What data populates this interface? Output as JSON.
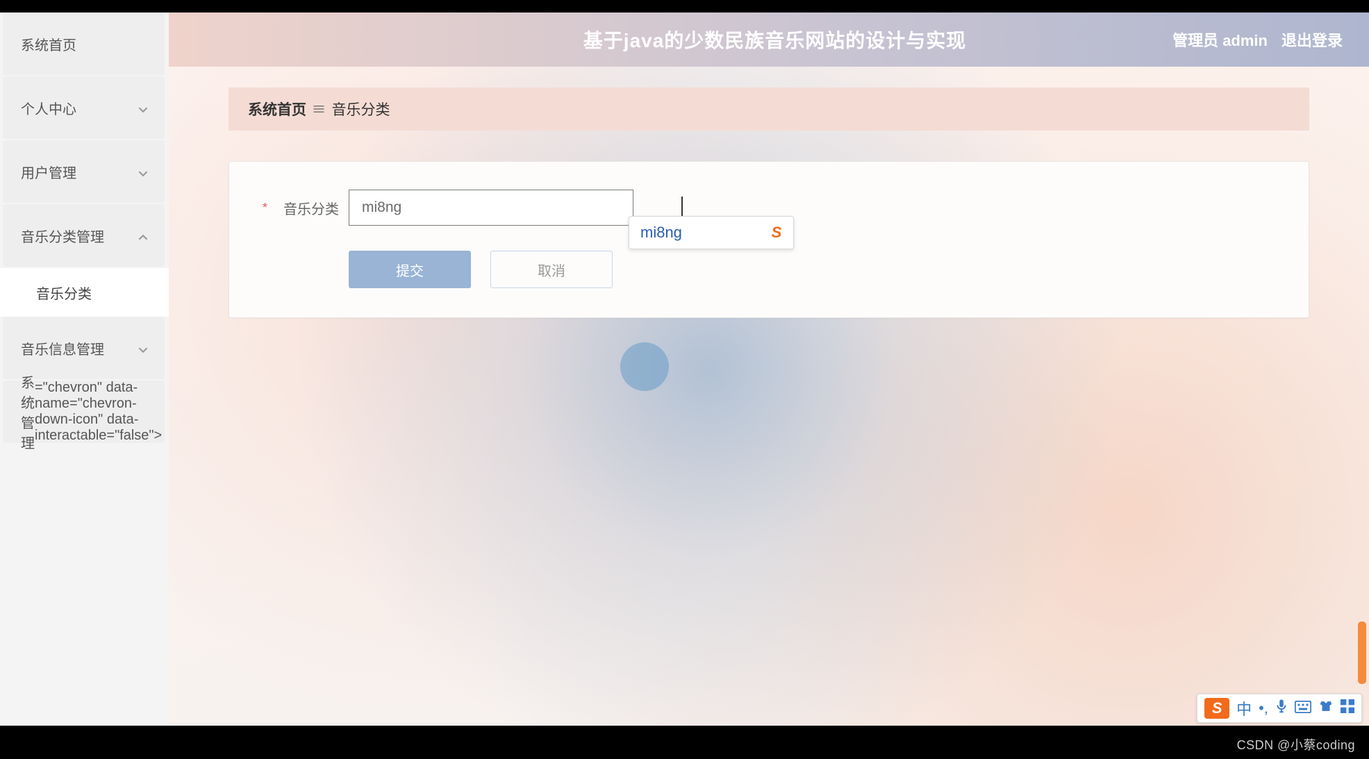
{
  "header": {
    "title": "基于java的少数民族音乐网站的设计与实现",
    "admin_label": "管理员 admin",
    "logout_label": "退出登录"
  },
  "sidebar": {
    "items": [
      {
        "label": "系统首页",
        "expandable": false
      },
      {
        "label": "个人中心",
        "expandable": true,
        "expanded": false
      },
      {
        "label": "用户管理",
        "expandable": true,
        "expanded": false
      },
      {
        "label": "音乐分类管理",
        "expandable": true,
        "expanded": true
      },
      {
        "label": "音乐信息管理",
        "expandable": true,
        "expanded": false
      },
      {
        "label": "系统管理",
        "expandable": true,
        "expanded": false
      }
    ],
    "sub_item": "音乐分类"
  },
  "breadcrumb": {
    "home": "系统首页",
    "current": "音乐分类"
  },
  "form": {
    "field_label": "音乐分类",
    "required_mark": "*",
    "input_value": "mi8ng",
    "submit_label": "提交",
    "cancel_label": "取消"
  },
  "ime": {
    "candidate": "mi8ng",
    "toolbar_lang": "中"
  },
  "watermark": "CSDN @小蔡coding"
}
